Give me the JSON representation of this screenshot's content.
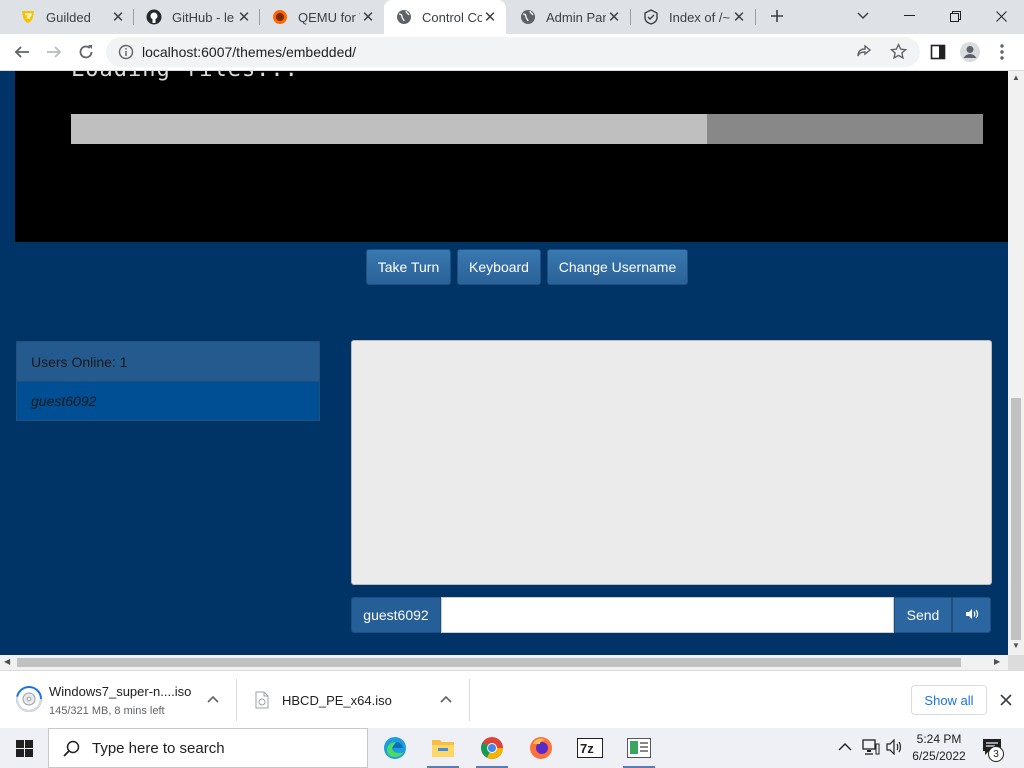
{
  "browser": {
    "tabs": [
      {
        "title": "Guilded",
        "icon": "guilded-icon"
      },
      {
        "title": "GitHub - le",
        "icon": "github-icon"
      },
      {
        "title": "QEMU for W",
        "icon": "qemu-icon"
      },
      {
        "title": "Control Co",
        "icon": "globe-icon",
        "active": true
      },
      {
        "title": "Admin Pan",
        "icon": "globe-icon"
      },
      {
        "title": "Index of /~",
        "icon": "index-icon"
      }
    ],
    "url": "localhost:6007/themes/embedded/"
  },
  "page": {
    "loading_text": "Loading files...",
    "loading_progress": 0.697,
    "buttons": {
      "take_turn": "Take Turn",
      "keyboard": "Keyboard",
      "change_username": "Change Username"
    },
    "users_online_label": "Users Online: 1",
    "users": [
      "guest6092"
    ],
    "chat": {
      "username": "guest6092",
      "input_value": "",
      "send_label": "Send"
    }
  },
  "downloads": {
    "items": [
      {
        "name": "Windows7_super-n....iso",
        "status": "145/321 MB, 8 mins left"
      },
      {
        "name": "HBCD_PE_x64.iso",
        "status": ""
      }
    ],
    "show_all": "Show all"
  },
  "taskbar": {
    "search_placeholder": "Type here to search",
    "time": "5:24 PM",
    "date": "6/25/2022",
    "notification_count": "3",
    "apps": [
      "edge-icon",
      "file-explorer-icon",
      "chrome-icon",
      "firefox-icon",
      "7zip-icon",
      "app-icon"
    ]
  }
}
